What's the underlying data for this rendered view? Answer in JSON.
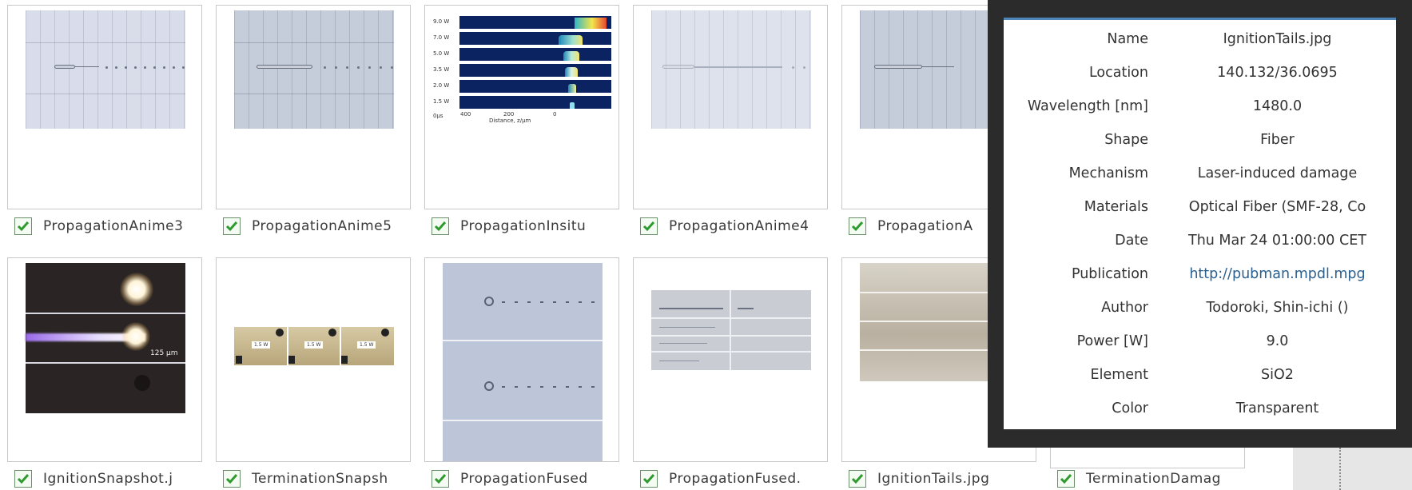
{
  "gallery": {
    "items": [
      {
        "caption": "PropagationAnime3",
        "checked": true,
        "thumb": "propagation-light"
      },
      {
        "caption": "PropagationAnime5",
        "checked": true,
        "thumb": "propagation"
      },
      {
        "caption": "PropagationInsitu",
        "checked": true,
        "thumb": "insitu-plot"
      },
      {
        "caption": "PropagationAnime4",
        "checked": true,
        "thumb": "propagation-faint"
      },
      {
        "caption": "PropagationA",
        "checked": true,
        "thumb": "propagation"
      },
      {
        "caption": "IgnitionSnapshot.j",
        "checked": true,
        "thumb": "ignition-snapshot"
      },
      {
        "caption": "TerminationSnapsh",
        "checked": true,
        "thumb": "termination-snapshot"
      },
      {
        "caption": "PropagationFused",
        "checked": true,
        "thumb": "propagation-fused-1"
      },
      {
        "caption": "PropagationFused.",
        "checked": true,
        "thumb": "propagation-fused-2"
      },
      {
        "caption": "IgnitionTails.jpg",
        "checked": true,
        "thumb": "ignition-tails"
      },
      {
        "caption": "TerminationDamag",
        "checked": true,
        "thumb": "termination-damage"
      }
    ],
    "insitu_plot": {
      "power_labels": [
        "9.0 W",
        "7.0 W",
        "5.0 W",
        "3.5 W",
        "2.0 W",
        "1.5 W"
      ],
      "x_ticks": [
        "400",
        "200",
        "0"
      ],
      "x_label": "Distance, z/μm",
      "corner_label": "0μs"
    },
    "ignition_snapshot": {
      "scale_label": "125 μm"
    },
    "termination_snapshot": {
      "tags": [
        "1.5 W",
        "1.5 W",
        "1.5 W"
      ]
    }
  },
  "info_panel": {
    "rows": [
      {
        "label": "Name",
        "value": "IgnitionTails.jpg"
      },
      {
        "label": "Location",
        "value": "140.132/36.0695"
      },
      {
        "label": "Wavelength [nm]",
        "value": "1480.0"
      },
      {
        "label": "Shape",
        "value": "Fiber"
      },
      {
        "label": "Mechanism",
        "value": "Laser-induced damage"
      },
      {
        "label": "Materials",
        "value": "Optical Fiber (SMF-28, Co"
      },
      {
        "label": "Date",
        "value": "Thu Mar 24 01:00:00 CET"
      },
      {
        "label": "Publication",
        "value": "http://pubman.mpdl.mpg",
        "link": true
      },
      {
        "label": "Author",
        "value": "Todoroki, Shin-ichi ()"
      },
      {
        "label": "Power [W]",
        "value": "9.0"
      },
      {
        "label": "Element",
        "value": "SiO2"
      },
      {
        "label": "Color",
        "value": "Transparent"
      }
    ]
  },
  "colors": {
    "accent": "#4f86b8",
    "check": "#2e9a2e",
    "panel_bg": "#2b2b2b",
    "link": "#2a5f8f"
  }
}
